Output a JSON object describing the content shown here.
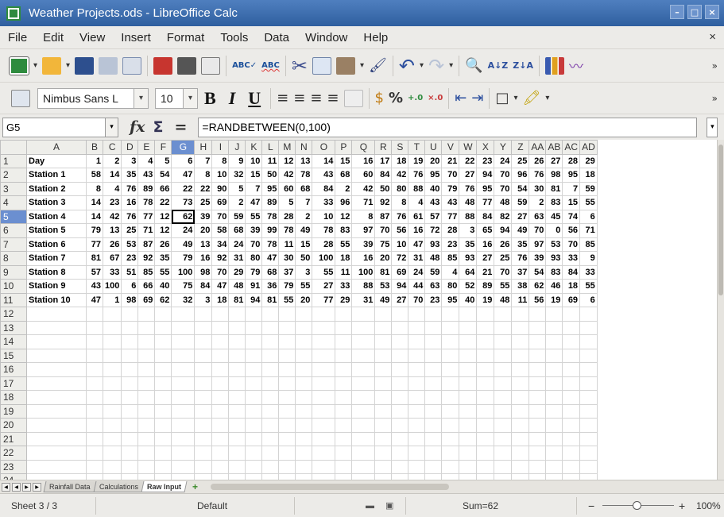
{
  "window": {
    "title": "Weather Projects.ods - LibreOffice Calc"
  },
  "menu": [
    "File",
    "Edit",
    "View",
    "Insert",
    "Format",
    "Tools",
    "Data",
    "Window",
    "Help"
  ],
  "toolbar": {
    "font_name": "Nimbus Sans L",
    "font_size": "10",
    "bold": "B",
    "italic": "I",
    "underline": "U",
    "percent": "%"
  },
  "formula": {
    "cell_ref": "G5",
    "content": "=RANDBETWEEN(0,100)",
    "fx": "fx",
    "sigma": "Σ",
    "equals": "="
  },
  "columns": [
    "A",
    "B",
    "C",
    "D",
    "E",
    "F",
    "G",
    "H",
    "I",
    "J",
    "K",
    "L",
    "M",
    "N",
    "O",
    "P",
    "Q",
    "R",
    "S",
    "T",
    "U",
    "V",
    "W",
    "X",
    "Y",
    "Z",
    "AA",
    "AB",
    "AC",
    "AD"
  ],
  "header_row": {
    "label": "Day",
    "values": [
      1,
      2,
      3,
      4,
      5,
      6,
      7,
      8,
      9,
      10,
      11,
      12,
      13,
      14,
      15,
      16,
      17,
      18,
      19,
      20,
      21,
      22,
      23,
      24,
      25,
      26,
      27,
      28,
      29
    ]
  },
  "rows": [
    {
      "label": "Station 1",
      "values": [
        58,
        14,
        35,
        43,
        54,
        47,
        8,
        10,
        32,
        15,
        50,
        42,
        78,
        43,
        68,
        60,
        84,
        42,
        76,
        95,
        70,
        27,
        94,
        70,
        96,
        76,
        98,
        95,
        18
      ]
    },
    {
      "label": "Station 2",
      "values": [
        8,
        4,
        76,
        89,
        66,
        22,
        22,
        90,
        5,
        7,
        95,
        60,
        68,
        84,
        2,
        42,
        50,
        80,
        88,
        40,
        79,
        76,
        95,
        70,
        54,
        30,
        81,
        7,
        59
      ]
    },
    {
      "label": "Station 3",
      "values": [
        14,
        23,
        16,
        78,
        22,
        73,
        25,
        69,
        2,
        47,
        89,
        5,
        7,
        33,
        96,
        71,
        92,
        8,
        4,
        43,
        43,
        48,
        77,
        48,
        59,
        2,
        83,
        15,
        55
      ]
    },
    {
      "label": "Station 4",
      "values": [
        14,
        42,
        76,
        77,
        12,
        62,
        39,
        70,
        59,
        55,
        78,
        28,
        2,
        10,
        12,
        8,
        87,
        76,
        61,
        57,
        77,
        88,
        84,
        82,
        27,
        63,
        45,
        74,
        6
      ]
    },
    {
      "label": "Station 5",
      "values": [
        79,
        13,
        25,
        71,
        12,
        24,
        20,
        58,
        68,
        39,
        99,
        78,
        49,
        78,
        83,
        97,
        70,
        56,
        16,
        72,
        28,
        3,
        65,
        94,
        49,
        70,
        0,
        56,
        71
      ]
    },
    {
      "label": "Station 6",
      "values": [
        77,
        26,
        53,
        87,
        26,
        49,
        13,
        34,
        24,
        70,
        78,
        11,
        15,
        28,
        55,
        39,
        75,
        10,
        47,
        93,
        23,
        35,
        16,
        26,
        35,
        97,
        53,
        70,
        85
      ]
    },
    {
      "label": "Station 7",
      "values": [
        81,
        67,
        23,
        92,
        35,
        79,
        16,
        92,
        31,
        80,
        47,
        30,
        50,
        100,
        18,
        16,
        20,
        72,
        31,
        48,
        85,
        93,
        27,
        25,
        76,
        39,
        93,
        33,
        9
      ]
    },
    {
      "label": "Station 8",
      "values": [
        57,
        33,
        51,
        85,
        55,
        100,
        98,
        70,
        29,
        79,
        68,
        37,
        3,
        55,
        11,
        100,
        81,
        69,
        24,
        59,
        4,
        64,
        21,
        70,
        37,
        54,
        83,
        84,
        33
      ]
    },
    {
      "label": "Station 9",
      "values": [
        43,
        100,
        6,
        66,
        40,
        75,
        84,
        47,
        48,
        91,
        36,
        79,
        55,
        27,
        33,
        88,
        53,
        94,
        44,
        63,
        80,
        52,
        89,
        55,
        38,
        62,
        46,
        18,
        55
      ]
    },
    {
      "label": "Station 10",
      "values": [
        47,
        1,
        98,
        69,
        62,
        32,
        3,
        18,
        81,
        94,
        81,
        55,
        20,
        77,
        29,
        31,
        49,
        27,
        70,
        23,
        95,
        40,
        19,
        48,
        11,
        56,
        19,
        69,
        6
      ]
    }
  ],
  "row_numbers": [
    1,
    2,
    3,
    4,
    5,
    6,
    7,
    8,
    9,
    10,
    11,
    12,
    13,
    14,
    15,
    16,
    17,
    18,
    19,
    20,
    21,
    22,
    23,
    24
  ],
  "sheet_tabs": [
    {
      "label": "Rainfall Data",
      "active": false
    },
    {
      "label": "Calculations",
      "active": false
    },
    {
      "label": "Raw Input",
      "active": true
    }
  ],
  "status": {
    "sheet": "Sheet 3 / 3",
    "page_style": "Default",
    "sum": "Sum=62",
    "zoom": "100%"
  }
}
